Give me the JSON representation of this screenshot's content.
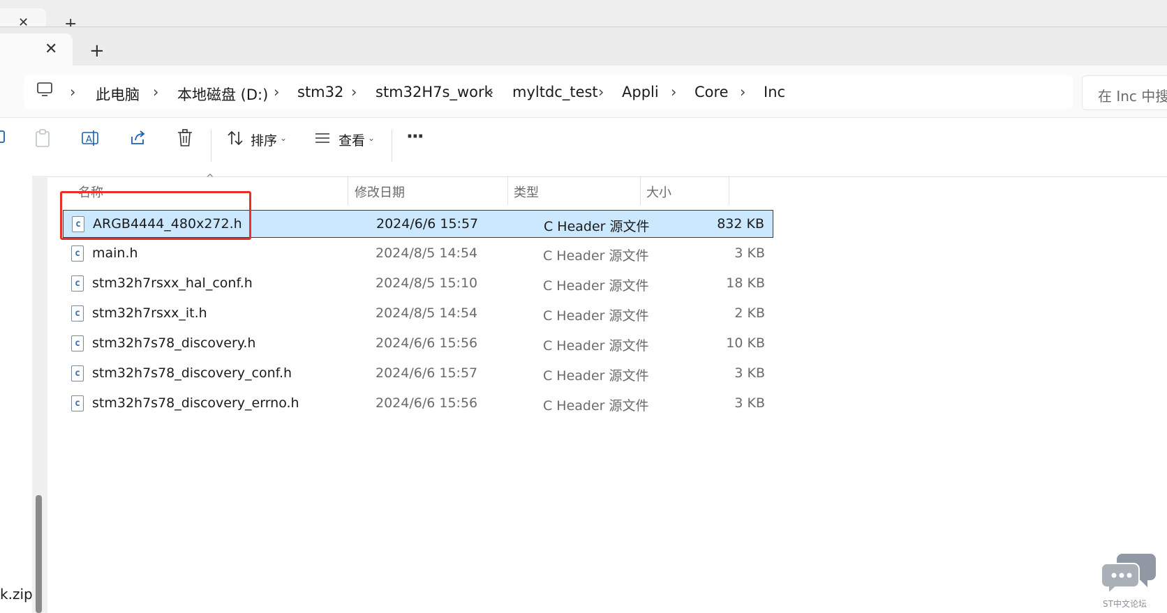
{
  "tabbar": {
    "close_glyph": "✕",
    "new_tab_glyph": "+"
  },
  "address": {
    "crumbs": [
      "此电脑",
      "本地磁盘 (D:)",
      "stm32",
      "stm32H7s_work",
      "myltdc_test",
      "Appli",
      "Core",
      "Inc"
    ],
    "search_placeholder": "在 Inc 中搜"
  },
  "command_bar": {
    "sort_label": "排序",
    "view_label": "查看",
    "more_glyph": "···"
  },
  "columns": {
    "name": "名称",
    "date": "修改日期",
    "type": "类型",
    "size": "大小"
  },
  "files": [
    {
      "name": "ARGB4444_480x272.h",
      "date": "2024/6/6 15:57",
      "type": "C Header 源文件",
      "size": "832 KB",
      "selected": true
    },
    {
      "name": "main.h",
      "date": "2024/8/5 14:54",
      "type": "C Header 源文件",
      "size": "3 KB"
    },
    {
      "name": "stm32h7rsxx_hal_conf.h",
      "date": "2024/8/5 15:10",
      "type": "C Header 源文件",
      "size": "18 KB"
    },
    {
      "name": "stm32h7rsxx_it.h",
      "date": "2024/8/5 14:54",
      "type": "C Header 源文件",
      "size": "2 KB"
    },
    {
      "name": "stm32h7s78_discovery.h",
      "date": "2024/6/6 15:56",
      "type": "C Header 源文件",
      "size": "10 KB"
    },
    {
      "name": "stm32h7s78_discovery_conf.h",
      "date": "2024/6/6 15:57",
      "type": "C Header 源文件",
      "size": "3 KB"
    },
    {
      "name": "stm32h7s78_discovery_errno.h",
      "date": "2024/6/6 15:56",
      "type": "C Header 源文件",
      "size": "3 KB"
    }
  ],
  "nav": {
    "partial_item": "k.zip"
  },
  "watermark": {
    "text": "ST中文论坛"
  },
  "colors": {
    "selection": "#cce8ff",
    "annotation": "#e8302a",
    "file_icon": "#3a6ea5"
  }
}
